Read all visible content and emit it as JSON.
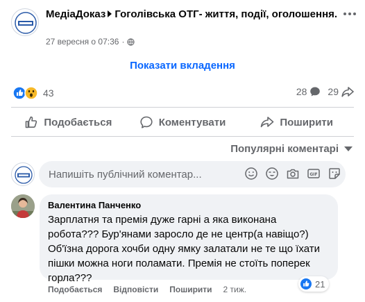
{
  "post": {
    "page_name": "МедіаДоказ",
    "group_name": "Гоголівська ОТГ- життя, події, оголошення.",
    "timestamp": "27 вересня о 07:36",
    "separator": "·",
    "show_attachments_label": "Показати вкладення"
  },
  "stats": {
    "reactions_count": "43",
    "comments_count": "28",
    "shares_count": "29"
  },
  "actions": {
    "like": "Подобається",
    "comment": "Коментувати",
    "share": "Поширити"
  },
  "sort": {
    "label": "Популярні коментарі"
  },
  "composer": {
    "placeholder": "Напишіть публічний коментар..."
  },
  "comment": {
    "author": "Валентина Панченко",
    "text": "Зарплатня та премія дуже гарні а яка виконана робота??? Бур'янами заросло де не центр(а навіщо?) Об'їзна дорога хочби одну ямку залатали не те що їхати пішки можна ноги поламати. Премія не стоїть поперек горла???",
    "like_label": "Подобається",
    "reply_label": "Відповісти",
    "share_label": "Поширити",
    "time": "2 тиж.",
    "reactions_count": "21"
  },
  "colors": {
    "accent": "#0866ff",
    "secondary_text": "#65676b",
    "bubble_bg": "#f0f2f5",
    "like_blue": "#1877f2",
    "reaction_yellow": "#f7b928"
  },
  "icons": {
    "reactions": [
      "like-icon",
      "wow-icon"
    ],
    "stats": [
      "comment-icon",
      "share-icon"
    ],
    "actions": [
      "thumbs-up-icon",
      "speech-bubble-icon",
      "share-arrow-icon"
    ],
    "composer_tools": [
      "smiley-icon",
      "emoji-face-icon",
      "camera-icon",
      "gif-icon",
      "sticker-icon"
    ]
  }
}
